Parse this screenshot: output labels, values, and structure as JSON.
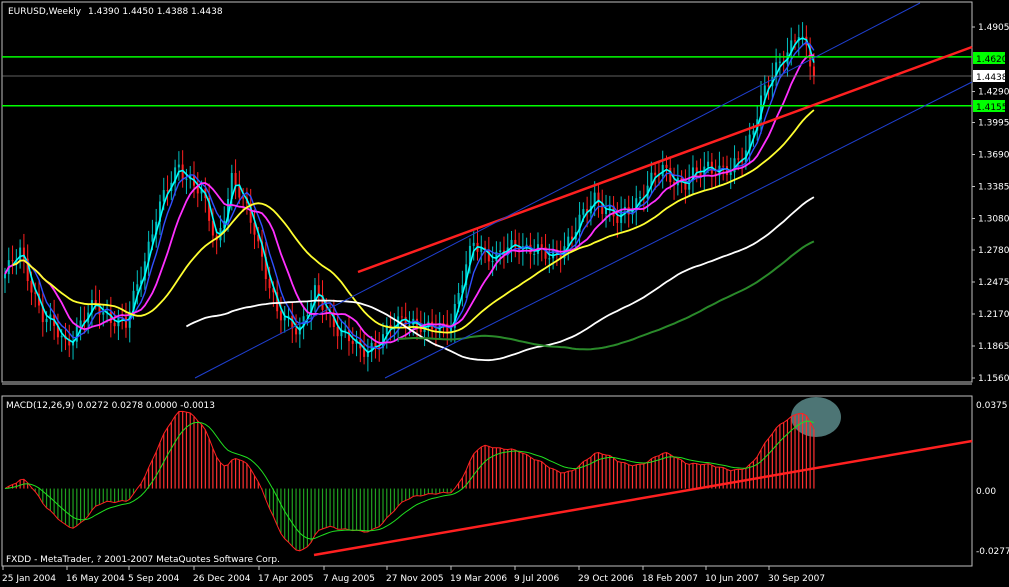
{
  "header": {
    "symbol": "EURUSD,Weekly",
    "ohlc": "1.4390 1.4450 1.4388 1.4438"
  },
  "macd": {
    "label": "MACD(12,26,9) 0.0272 0.0278 0.0000 -0.0013",
    "y_ticks": [
      "0.0375",
      "0.00",
      "-0.0277"
    ]
  },
  "copyright": "FXDD - MetaTrader, ? 2001-2007 MetaQuotes Software Corp.",
  "price_axis": {
    "ticks": [
      "1.4905",
      "1.4290",
      "1.3995",
      "1.3690",
      "1.3385",
      "1.3080",
      "1.2780",
      "1.2475",
      "1.2170",
      "1.1865",
      "1.1560"
    ]
  },
  "tags": {
    "hline_upper": "1.4620",
    "hline_lower": "1.4155",
    "current_price": "1.4438"
  },
  "time_axis": {
    "labels": [
      "25 Jan 2004",
      "16 May 2004",
      "5 Sep 2004",
      "26 Dec 2004",
      "17 Apr 2005",
      "7 Aug 2005",
      "27 Nov 2005",
      "19 Mar 2006",
      "9 Jul 2006",
      "29 Oct 2006",
      "18 Feb 2007",
      "10 Jun 2007",
      "30 Sep 2007"
    ]
  },
  "colors": {
    "background": "#000000",
    "grid_frame": "#c0c0c0",
    "candle_up": "#00c0c0",
    "candle_down": "#ff2020",
    "hline": "#00ff00",
    "trendline": "#ff2020",
    "channel": "#1f3fd0",
    "ma_cyan": "#00ffff",
    "ma_blue": "#3050ff",
    "ma_magenta": "#ff30ff",
    "ma_yellow": "#ffff30",
    "ma_white": "#ffffff",
    "ma_green": "#2a8a2a",
    "macd_line": "#ff2020",
    "signal_line": "#20e020",
    "hist_up": "#ff3030",
    "hist_down": "#20a020",
    "highlight": "#5a8a8a"
  },
  "chart_data": {
    "type": "candlestick",
    "title": "EURUSD,Weekly",
    "ylim": [
      1.156,
      1.5
    ],
    "xlabels": [
      "25 Jan 2004",
      "16 May 2004",
      "5 Sep 2004",
      "26 Dec 2004",
      "17 Apr 2005",
      "7 Aug 2005",
      "27 Nov 2005",
      "19 Mar 2006",
      "9 Jul 2006",
      "29 Oct 2006",
      "18 Feb 2007",
      "10 Jun 2007",
      "30 Sep 2007"
    ],
    "last_bar": {
      "open": 1.439,
      "high": 1.445,
      "low": 1.4388,
      "close": 1.4438
    },
    "horizontal_lines": [
      1.462,
      1.4155
    ],
    "price_path_anchors": [
      {
        "bar": 0,
        "price": 1.255
      },
      {
        "bar": 4,
        "price": 1.275
      },
      {
        "bar": 10,
        "price": 1.215
      },
      {
        "bar": 16,
        "price": 1.19
      },
      {
        "bar": 24,
        "price": 1.225
      },
      {
        "bar": 32,
        "price": 1.205
      },
      {
        "bar": 40,
        "price": 1.31
      },
      {
        "bar": 46,
        "price": 1.36
      },
      {
        "bar": 52,
        "price": 1.33
      },
      {
        "bar": 56,
        "price": 1.285
      },
      {
        "bar": 60,
        "price": 1.345
      },
      {
        "bar": 66,
        "price": 1.3
      },
      {
        "bar": 72,
        "price": 1.215
      },
      {
        "bar": 78,
        "price": 1.205
      },
      {
        "bar": 82,
        "price": 1.235
      },
      {
        "bar": 88,
        "price": 1.205
      },
      {
        "bar": 94,
        "price": 1.18
      },
      {
        "bar": 100,
        "price": 1.195
      },
      {
        "bar": 106,
        "price": 1.215
      },
      {
        "bar": 112,
        "price": 1.2
      },
      {
        "bar": 118,
        "price": 1.21
      },
      {
        "bar": 124,
        "price": 1.285
      },
      {
        "bar": 130,
        "price": 1.27
      },
      {
        "bar": 136,
        "price": 1.285
      },
      {
        "bar": 144,
        "price": 1.27
      },
      {
        "bar": 150,
        "price": 1.29
      },
      {
        "bar": 156,
        "price": 1.33
      },
      {
        "bar": 162,
        "price": 1.305
      },
      {
        "bar": 168,
        "price": 1.33
      },
      {
        "bar": 174,
        "price": 1.355
      },
      {
        "bar": 180,
        "price": 1.34
      },
      {
        "bar": 186,
        "price": 1.36
      },
      {
        "bar": 192,
        "price": 1.35
      },
      {
        "bar": 196,
        "price": 1.375
      },
      {
        "bar": 200,
        "price": 1.42
      },
      {
        "bar": 206,
        "price": 1.465
      },
      {
        "bar": 210,
        "price": 1.485
      },
      {
        "bar": 214,
        "price": 1.4438
      }
    ],
    "indicators": [
      "Moving averages (5 periods, several lengths)",
      "MACD(12,26,9)"
    ],
    "macd_values": {
      "macd": 0.0272,
      "signal": 0.0278,
      "histogram": 0.0,
      "extra": -0.0013
    }
  }
}
